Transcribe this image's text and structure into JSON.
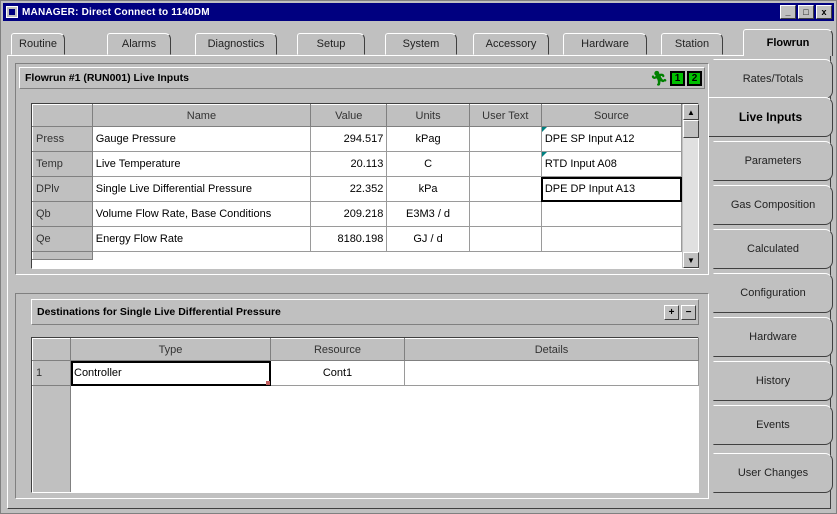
{
  "window": {
    "title": "MANAGER: Direct Connect to 1140DM",
    "min": "_",
    "max": "□",
    "close": "x"
  },
  "top_tabs": [
    {
      "label": "Routine"
    },
    {
      "label": "Alarms"
    },
    {
      "label": "Diagnostics"
    },
    {
      "label": "Setup"
    },
    {
      "label": "System"
    },
    {
      "label": "Accessory"
    },
    {
      "label": "Hardware"
    },
    {
      "label": "Station"
    },
    {
      "label": "Flowrun",
      "active": true
    }
  ],
  "side_tabs": [
    {
      "label": "Rates/Totals"
    },
    {
      "label": "Live Inputs",
      "active": true
    },
    {
      "label": "Parameters"
    },
    {
      "label": "Gas Composition"
    },
    {
      "label": "Calculated"
    },
    {
      "label": "Configuration"
    },
    {
      "label": "Hardware"
    },
    {
      "label": "History"
    },
    {
      "label": "Events"
    },
    {
      "label": "User Changes"
    }
  ],
  "live_inputs": {
    "title": "Flowrun #1 (RUN001) Live Inputs",
    "status_icon": "running-man-icon",
    "box1": "1",
    "box2": "2",
    "columns": [
      "Name",
      "Value",
      "Units",
      "User Text",
      "Source"
    ],
    "rows": [
      {
        "tag": "Press",
        "name": "Gauge Pressure",
        "value": "294.517",
        "units": "kPag",
        "user_text": "",
        "source": "DPE SP Input A12"
      },
      {
        "tag": "Temp",
        "name": "Live Temperature",
        "value": "20.113",
        "units": "C",
        "user_text": "",
        "source": "RTD Input A08"
      },
      {
        "tag": "DPlv",
        "name": "Single Live Differential Pressure",
        "value": "22.352",
        "units": "kPa",
        "user_text": "",
        "source": "DPE DP Input A13"
      },
      {
        "tag": "Qb",
        "name": "Volume Flow Rate, Base Conditions",
        "value": "209.218",
        "units": "E3M3 / d",
        "user_text": "",
        "source": ""
      },
      {
        "tag": "Qe",
        "name": "Energy Flow Rate",
        "value": "8180.198",
        "units": "GJ / d",
        "user_text": "",
        "source": ""
      }
    ]
  },
  "destinations": {
    "title": "Destinations for Single Live Differential Pressure",
    "add_label": "+",
    "remove_label": "−",
    "columns": [
      "Type",
      "Resource",
      "Details"
    ],
    "rows": [
      {
        "index": "1",
        "type": "Controller",
        "resource": "Cont1",
        "details": ""
      }
    ]
  }
}
